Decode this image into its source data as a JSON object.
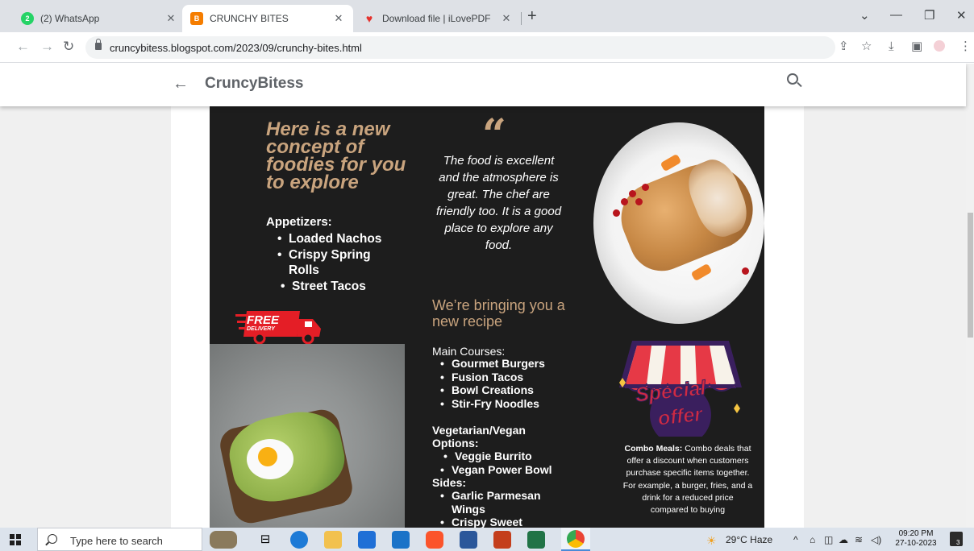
{
  "browser": {
    "tabs": [
      {
        "title": "(2) WhatsApp",
        "icon": "whatsapp-icon",
        "badge": "2",
        "color": "#25d366"
      },
      {
        "title": "CRUNCHY BITES",
        "icon": "blogger-icon",
        "badge": "B",
        "color": "#f57d00"
      },
      {
        "title": "Download file | iLovePDF",
        "icon": "ilovepdf-heart-icon",
        "badge": "",
        "color": "#e5322d"
      }
    ],
    "url": "cruncybitess.blogspot.com/2023/09/crunchy-bites.html"
  },
  "blog": {
    "title": "CruncyBitess"
  },
  "flyer": {
    "headline": "Here is a new concept of foodies for you to explore",
    "appetizers": {
      "heading": "Appetizers:",
      "items": [
        "Loaded Nachos",
        "Crispy Spring Rolls",
        "Street Tacos"
      ]
    },
    "quote": "The food is excellent and the atmosphere is great. The chef are friendly too. It is a good place to explore any food.",
    "bringing": "We’re bringing you a new recipe",
    "main_courses": {
      "heading": "Main Courses:",
      "items": [
        "Gourmet Burgers",
        "Fusion Tacos",
        "Bowl Creations",
        "Stir-Fry Noodles"
      ]
    },
    "veg": {
      "heading": "Vegetarian/Vegan Options:",
      "items": [
        "Veggie Burrito",
        "Vegan Power Bowl"
      ]
    },
    "sides": {
      "heading": "Sides:",
      "items": [
        "Garlic Parmesan Wings",
        "Crispy Sweet"
      ]
    },
    "delivery_badge": {
      "line1": "FREE",
      "line2": "DELIVERY"
    },
    "special_offer": {
      "line1": "Special",
      "line2": "offer"
    },
    "combo": {
      "label": "Combo Meals:",
      "text": "Combo deals that offer a discount when customers purchase specific items together. For example, a burger, fries, and a drink for a reduced price compared to buying"
    },
    "colors": {
      "background": "#1d1d1d",
      "accent": "#c9a47e",
      "special_red": "#cf2a43"
    }
  },
  "taskbar": {
    "search_placeholder": "Type here to search",
    "weather": "29°C  Haze",
    "time": "09:20 PM",
    "date": "27-10-2023",
    "notification_count": "3"
  }
}
